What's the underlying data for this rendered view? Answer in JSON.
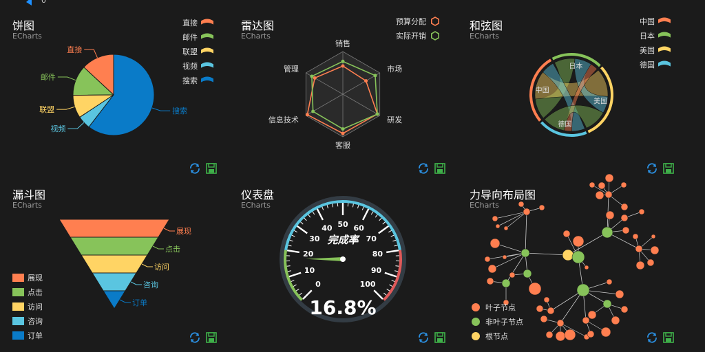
{
  "top_corner": {
    "value": "0"
  },
  "tool_icons": [
    "refresh-icon",
    "save-icon"
  ],
  "colors": {
    "red": "#ff7f50",
    "green": "#87c35a",
    "yellow": "#ffd464",
    "cyan": "#5ac5e0",
    "blue": "#0a7bc8",
    "bg": "#1b1b1b"
  },
  "chart_data": [
    {
      "type": "pie",
      "title": "饼图",
      "subtitle": "ECharts",
      "legend_position": "top-right",
      "slices": [
        {
          "name": "直接",
          "value": 335
        },
        {
          "name": "邮件",
          "value": 310
        },
        {
          "name": "联盟",
          "value": 234
        },
        {
          "name": "视频",
          "value": 135
        },
        {
          "name": "搜索",
          "value": 1548
        }
      ]
    },
    {
      "type": "radar",
      "title": "雷达图",
      "subtitle": "ECharts",
      "legend_position": "top-right",
      "indicators": [
        {
          "name": "销售",
          "max": 6500
        },
        {
          "name": "市场",
          "max": 16000
        },
        {
          "name": "研发",
          "max": 30000
        },
        {
          "name": "客服",
          "max": 38000
        },
        {
          "name": "信息技术",
          "max": 52000
        },
        {
          "name": "管理",
          "max": 25000
        }
      ],
      "series": [
        {
          "name": "预算分配",
          "values": [
            4300,
            10000,
            28000,
            35000,
            50000,
            19000
          ]
        },
        {
          "name": "实际开销",
          "values": [
            5000,
            14000,
            28000,
            31000,
            42000,
            21000
          ]
        }
      ]
    },
    {
      "type": "chord",
      "title": "和弦图",
      "subtitle": "ECharts",
      "legend_position": "top-right",
      "nodes": [
        "中国",
        "日本",
        "美国",
        "德国"
      ],
      "matrix": [
        [
          0,
          22,
          30,
          14
        ],
        [
          22,
          0,
          18,
          8
        ],
        [
          30,
          18,
          0,
          24
        ],
        [
          14,
          8,
          24,
          0
        ]
      ]
    },
    {
      "type": "funnel",
      "title": "漏斗图",
      "subtitle": "ECharts",
      "legend_position": "bottom-left",
      "stages": [
        {
          "name": "展现",
          "value": 100
        },
        {
          "name": "点击",
          "value": 80
        },
        {
          "name": "访问",
          "value": 60
        },
        {
          "name": "咨询",
          "value": 40
        },
        {
          "name": "订单",
          "value": 20
        }
      ]
    },
    {
      "type": "gauge",
      "title": "仪表盘",
      "subtitle": "ECharts",
      "range": [
        0,
        100
      ],
      "tick_labels": [
        "0",
        "10",
        "20",
        "30",
        "40",
        "50",
        "60",
        "70",
        "80",
        "90",
        "100"
      ],
      "value": 16.8,
      "value_label": "16.8%",
      "label": "完成率"
    },
    {
      "type": "force",
      "title": "力导向布局图",
      "subtitle": "ECharts",
      "legend_position": "bottom-left",
      "categories": [
        {
          "name": "叶子节点"
        },
        {
          "name": "非叶子节点"
        },
        {
          "name": "根节点"
        }
      ]
    }
  ]
}
